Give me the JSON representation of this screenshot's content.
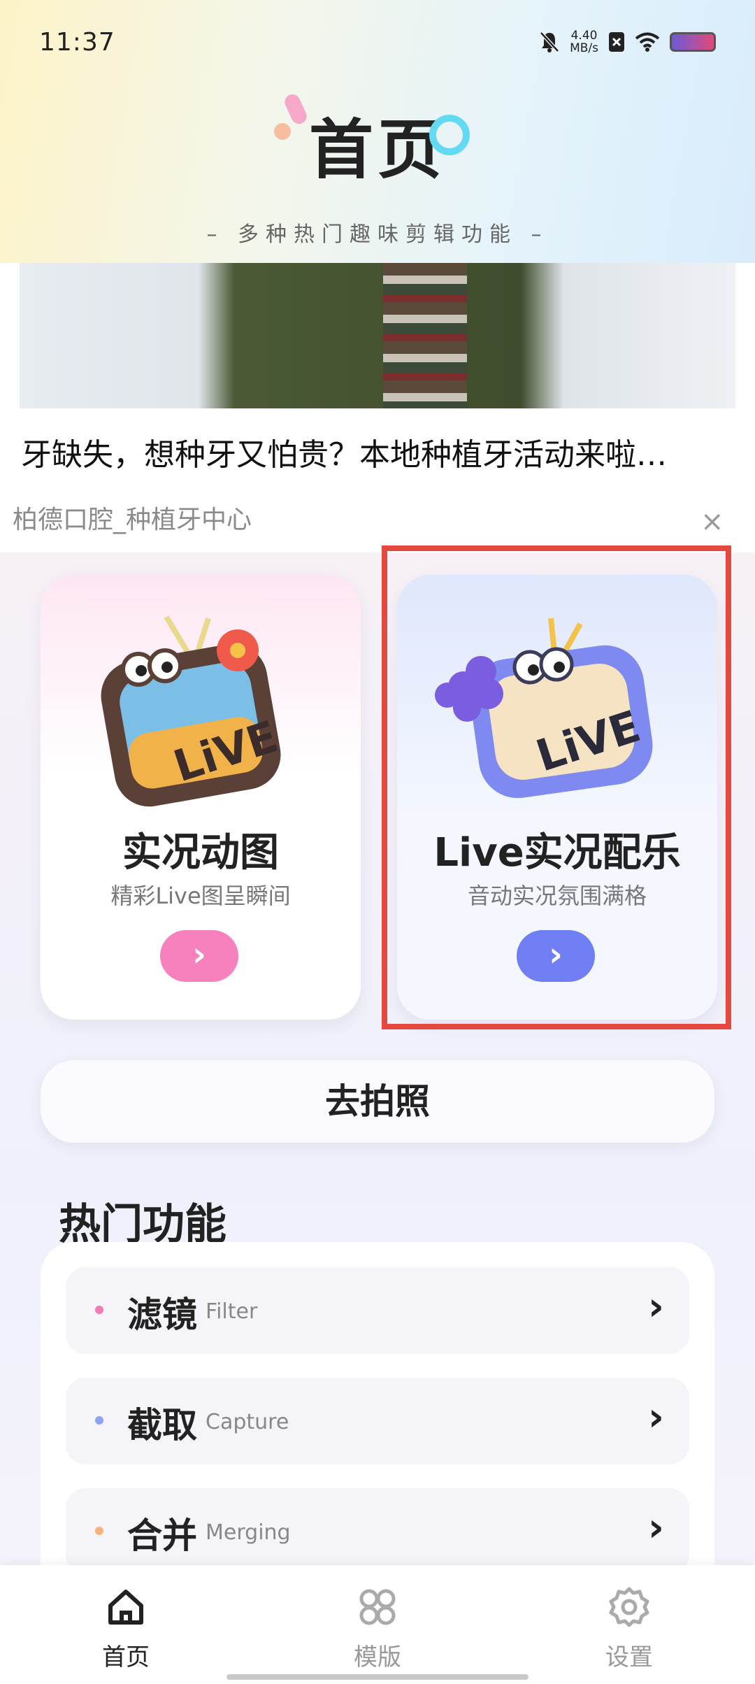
{
  "status_bar": {
    "time": "11:37",
    "net_speed_value": "4.40",
    "net_speed_unit": "MB/s"
  },
  "header": {
    "title": "首页",
    "subtitle": "– 多种热门趣味剪辑功能 –"
  },
  "ad": {
    "title": "牙缺失，想种牙又怕贵？本地种植牙活动来啦…",
    "source": "柏德口腔_种植牙中心",
    "close_label": "×"
  },
  "cards": [
    {
      "title": "实况动图",
      "subtitle": "精彩Live图呈瞬间",
      "art_text": "LiVE",
      "button": "›",
      "accent": "#f781bd"
    },
    {
      "title": "Live实况配乐",
      "subtitle": "音动实况氛围满格",
      "art_text": "LiVE",
      "button": "›",
      "accent": "#6f7ff3"
    }
  ],
  "photo_button": "去拍照",
  "hot_functions": {
    "title": "热门功能",
    "items": [
      {
        "name": "滤镜",
        "en": "Filter",
        "dot_color": "#f07cb4"
      },
      {
        "name": "截取",
        "en": "Capture",
        "dot_color": "#8fa2f5"
      },
      {
        "name": "合并",
        "en": "Merging",
        "dot_color": "#f6b27a"
      }
    ],
    "arrow": "›"
  },
  "tab_bar": {
    "tabs": [
      {
        "label": "首页",
        "icon": "home-icon",
        "active": true
      },
      {
        "label": "模版",
        "icon": "grid-icon",
        "active": false
      },
      {
        "label": "设置",
        "icon": "gear-icon",
        "active": false
      }
    ]
  }
}
